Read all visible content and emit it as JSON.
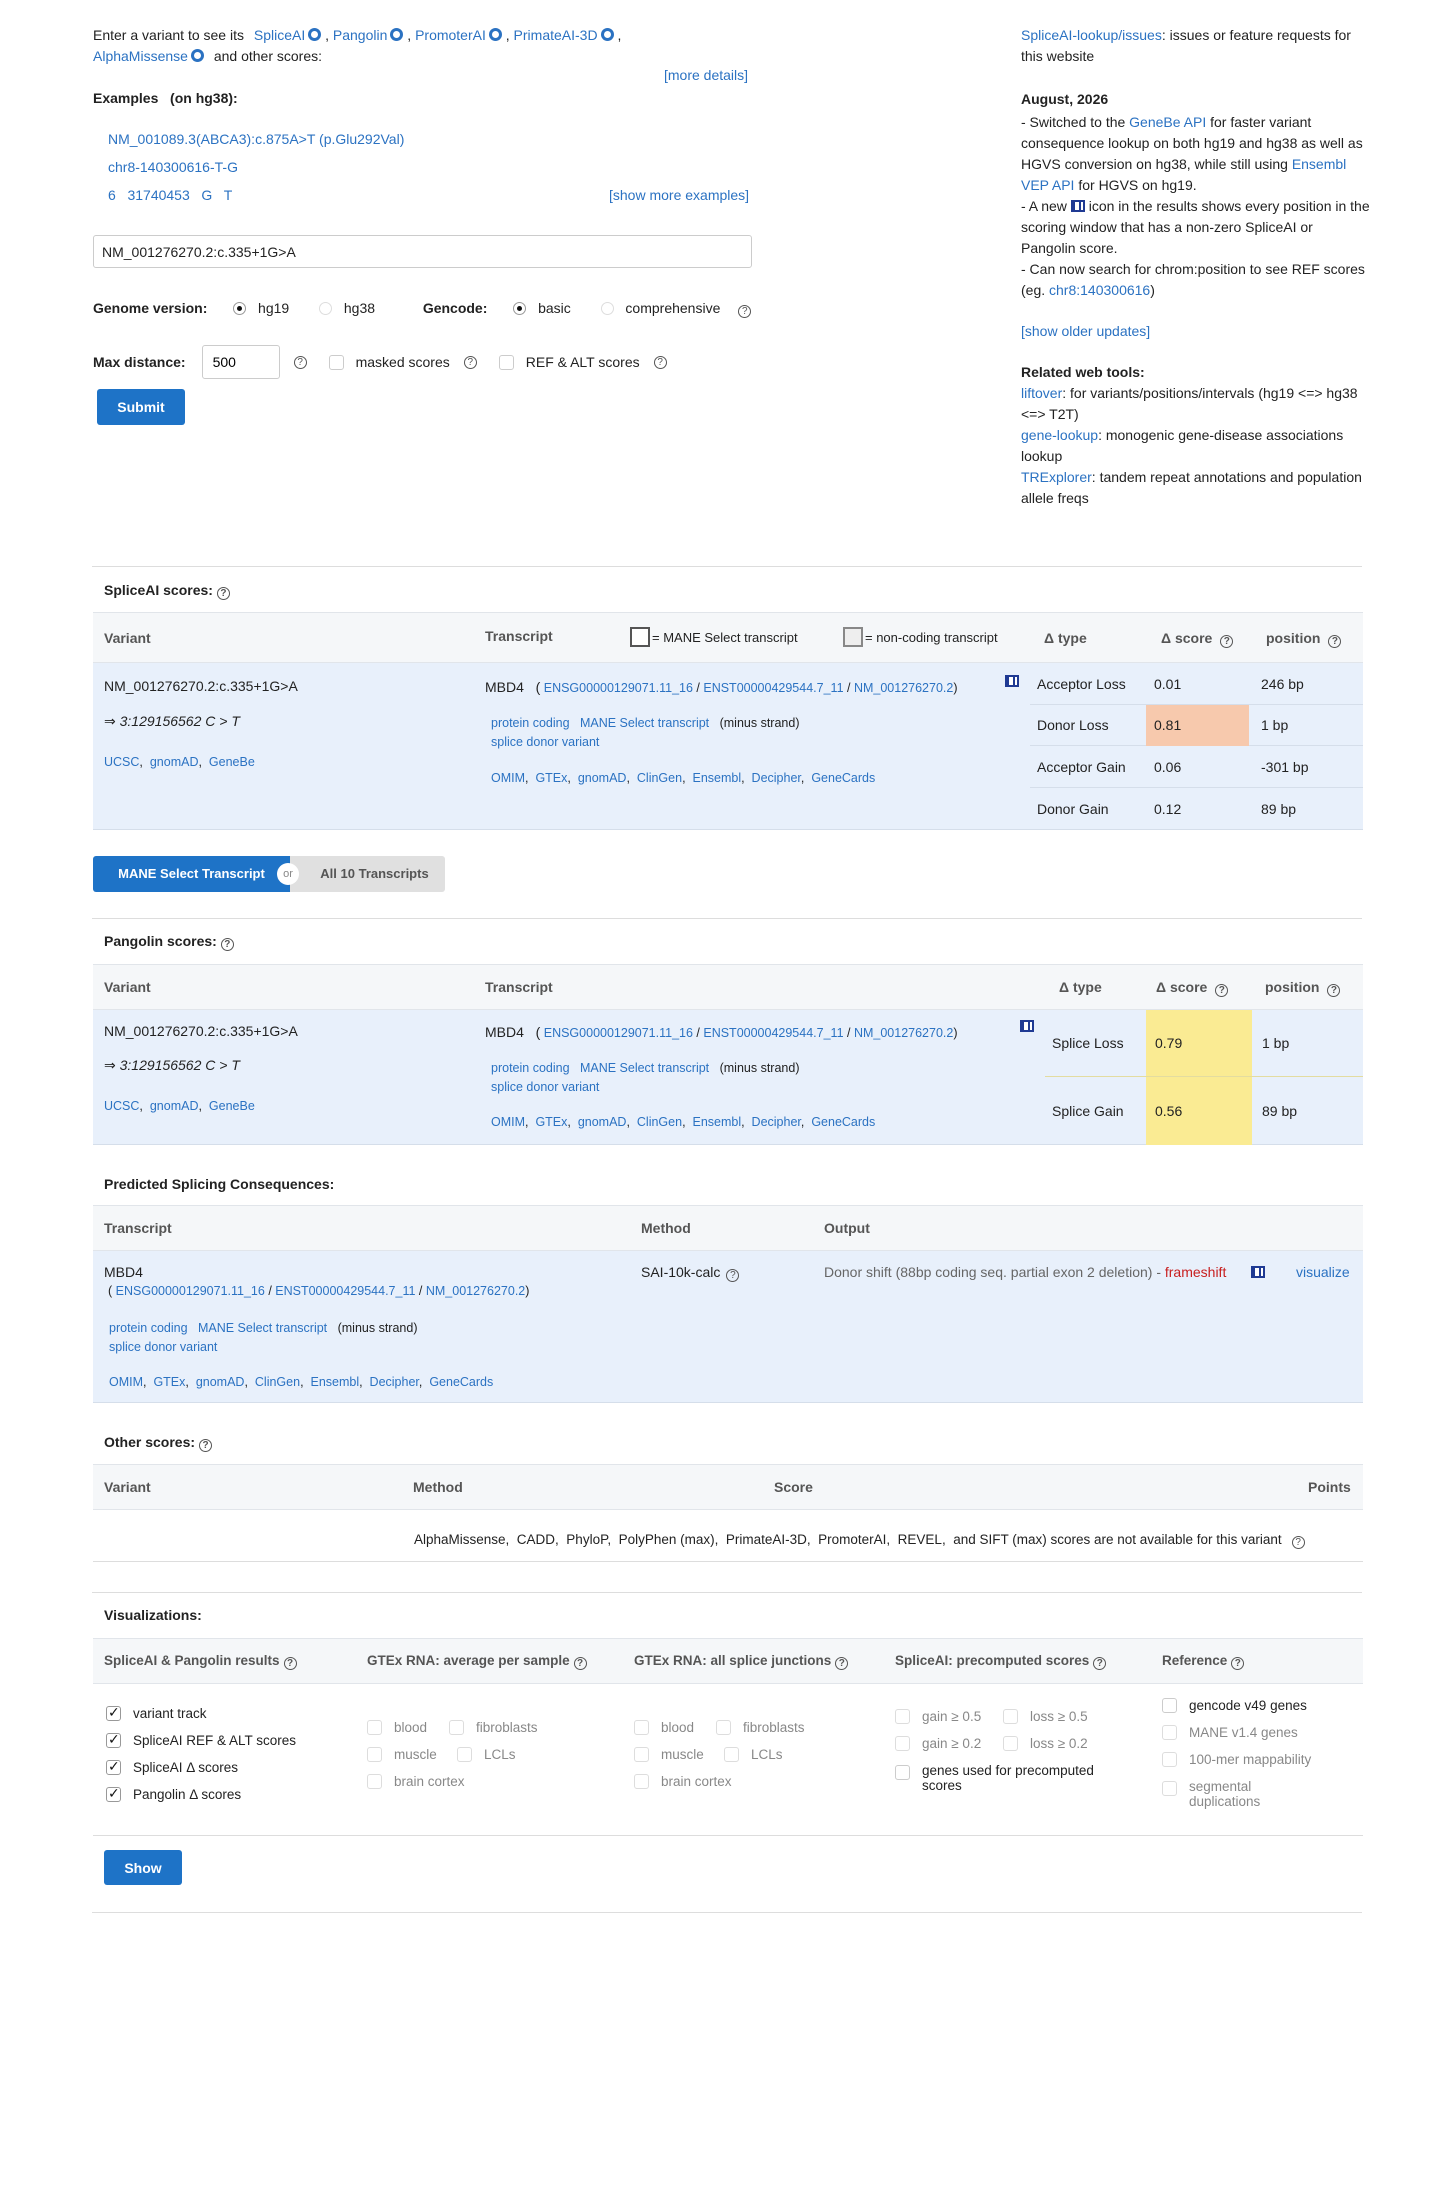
{
  "intro": {
    "prefix": "Enter a variant to see its",
    "tools": [
      "SpliceAI",
      "Pangolin",
      "PromoterAI",
      "PrimateAI-3D",
      "AlphaMissense"
    ],
    "suffix": "and other scores:",
    "more_details": "[more details]"
  },
  "examples": {
    "title": "Examples   (on hg38):",
    "items": [
      "NM_001089.3(ABCA3):c.875A>T (p.Glu292Val)",
      "chr8-140300616-T-G",
      "6   31740453   G   T"
    ],
    "show_more": "[show more examples]"
  },
  "search": {
    "value": "NM_001276270.2:c.335+1G>A"
  },
  "options": {
    "genome_label": "Genome version:",
    "genome_options": [
      "hg19",
      "hg38"
    ],
    "gencode_label": "Gencode:",
    "gencode_options": [
      "basic",
      "comprehensive"
    ],
    "max_distance_label": "Max distance:",
    "max_distance_value": "500",
    "masked_label": "masked scores",
    "ref_alt_label": "REF & ALT scores",
    "submit": "Submit"
  },
  "sidebar": {
    "issues_link": "SpliceAI-lookup/issues",
    "issues_text": ": issues or feature requests for this website",
    "update_date": "August, 2026",
    "u1_a": "- Switched to the ",
    "u1_link1": "GeneBe API",
    "u1_b": " for faster variant consequence lookup on both hg19 and hg38 as well as HGVS conversion on hg38, while still using ",
    "u1_link2": "Ensembl VEP API",
    "u1_c": " for HGVS on hg19.",
    "u2_a": "- A new ",
    "u2_b": " icon in the results shows every position in the scoring window that has a non-zero SpliceAI or Pangolin score.",
    "u3_a": "- Can now search for chrom:position to see REF scores (eg. ",
    "u3_link": "chr8:140300616",
    "u3_b": ")",
    "older_updates": "[show older updates]",
    "related_title": "Related web tools:",
    "tools": [
      {
        "name": "liftover",
        "desc": ": for variants/positions/intervals (hg19 <=> hg38 <=> T2T)"
      },
      {
        "name": "gene-lookup",
        "desc": ": monogenic gene-disease associations lookup"
      },
      {
        "name": "TRExplorer",
        "desc": ": tandem repeat annotations and population allele freqs"
      }
    ]
  },
  "spliceai": {
    "title": "SpliceAI scores:",
    "headers": {
      "variant": "Variant",
      "transcript": "Transcript",
      "mane_legend": "= MANE Select transcript",
      "noncoding_legend": "= non-coding transcript",
      "dtype": "Δ type",
      "dscore": "Δ score",
      "position": "position"
    },
    "variant": "NM_001276270.2:c.335+1G>A",
    "coords": "⇒ 3:129156562 C > T",
    "variant_links": [
      "UCSC",
      "gnomAD",
      "GeneBe"
    ],
    "gene": "MBD4",
    "ids": [
      "ENSG00000129071.11_16",
      "ENST00000429544.7_11",
      "NM_001276270.2"
    ],
    "tags": [
      "protein coding",
      "MANE Select transcript"
    ],
    "strand": "(minus strand)",
    "consequence": "splice donor variant",
    "db_links": [
      "OMIM",
      "GTEx",
      "gnomAD",
      "ClinGen",
      "Ensembl",
      "Decipher",
      "GeneCards"
    ],
    "rows": [
      {
        "type": "Acceptor Loss",
        "score": "0.01",
        "pos": "246 bp"
      },
      {
        "type": "Donor Loss",
        "score": "0.81",
        "pos": "1 bp"
      },
      {
        "type": "Acceptor Gain",
        "score": "0.06",
        "pos": "-301 bp"
      },
      {
        "type": "Donor Gain",
        "score": "0.12",
        "pos": "89 bp"
      }
    ],
    "highlight_color": "#f7c9ad"
  },
  "toggle": {
    "left": "MANE Select Transcript",
    "or": "or",
    "right": "All 10 Transcripts"
  },
  "pangolin": {
    "title": "Pangolin scores:",
    "headers": {
      "variant": "Variant",
      "transcript": "Transcript",
      "dtype": "Δ type",
      "dscore": "Δ score",
      "position": "position"
    },
    "rows": [
      {
        "type": "Splice Loss",
        "score": "0.79",
        "pos": "1 bp"
      },
      {
        "type": "Splice Gain",
        "score": "0.56",
        "pos": "89 bp"
      }
    ],
    "highlight_color": "#faeb93"
  },
  "consequences": {
    "title": "Predicted Splicing Consequences:",
    "headers": {
      "transcript": "Transcript",
      "method": "Method",
      "output": "Output"
    },
    "method": "SAI-10k-calc",
    "output_text": "Donor shift (88bp coding seq. partial exon 2 deletion) - ",
    "output_frameshift": "frameshift",
    "visualize": "visualize"
  },
  "other": {
    "title": "Other scores:",
    "headers": {
      "variant": "Variant",
      "method": "Method",
      "score": "Score",
      "points": "Points"
    },
    "message": "AlphaMissense,  CADD,  PhyloP,  PolyPhen (max),  PrimateAI-3D,  PromoterAI,  REVEL,  and SIFT (max) scores are not available for this variant"
  },
  "viz": {
    "title": "Visualizations:",
    "col_titles": [
      "SpliceAI & Pangolin results",
      "GTEx RNA: average per sample",
      "GTEx RNA: all splice junctions",
      "SpliceAI: precomputed scores",
      "Reference"
    ],
    "col1": [
      "variant track",
      "SpliceAI REF & ALT scores",
      "SpliceAI Δ scores",
      "Pangolin Δ scores"
    ],
    "gtex_avg": [
      "blood",
      "fibroblasts",
      "muscle",
      "LCLs",
      "brain cortex"
    ],
    "gtex_junc": [
      "blood",
      "fibroblasts",
      "muscle",
      "LCLs",
      "brain cortex"
    ],
    "precomp": [
      "gain ≥ 0.5",
      "loss ≥ 0.5",
      "gain ≥ 0.2",
      "loss ≥ 0.2",
      "genes used for precomputed scores"
    ],
    "reference": [
      "gencode v49 genes",
      "MANE v1.4 genes",
      "100-mer mappability",
      "segmental duplications"
    ],
    "show": "Show"
  }
}
